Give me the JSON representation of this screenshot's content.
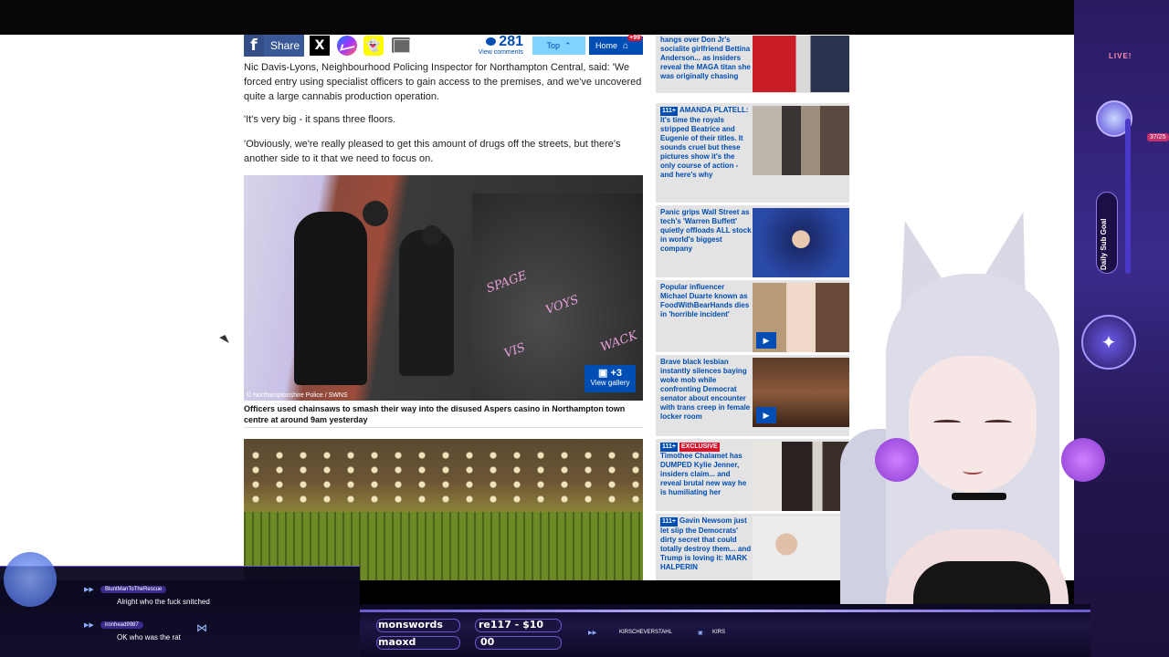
{
  "sharebar": {
    "share_label": "Share",
    "comments_count": "281",
    "comments_label": "View comments",
    "top_label": "Top",
    "home_label": "Home",
    "home_badge": "+99"
  },
  "article": {
    "p1": "Nic Davis-Lyons, Neighbourhood Policing Inspector for Northampton Central, said: 'We forced entry using specialist officers to gain access to the premises, and we've uncovered quite a large cannabis production operation.",
    "p2": "'It's very big - it spans three floors.",
    "p3": "'Obviously, we're really pleased to get this amount of drugs off the streets, but there's another side to it that we need to focus on.",
    "image_credit": "© Northamptonshire Police / SWNS",
    "gallery_count": "+3",
    "gallery_label": "View gallery",
    "caption": "Officers used chainsaws to smash their way into the disused Aspers casino in Northampton town centre at around 9am yesterday",
    "graffiti": [
      "SPAGE",
      "VOYS",
      "VIS",
      "WACK"
    ]
  },
  "sidebar": {
    "items": [
      {
        "tag": "",
        "text": "hangs over Don Jr's socialite girlfriend Bettina Anderson... as insiders reveal the MAGA titan she was originally chasing"
      },
      {
        "tag": "111+",
        "text": "AMANDA PLATELL: It's time the royals stripped Beatrice and Eugenie of their titles. It sounds cruel but these pictures show it's the only course of action - and here's why"
      },
      {
        "tag": "",
        "text": "Panic grips Wall Street as tech's 'Warren Buffett' quietly offloads ALL stock in world's biggest company"
      },
      {
        "tag": "",
        "text": "Popular influencer Michael Duarte known as FoodWithBearHands dies in 'horrible incident'"
      },
      {
        "tag": "",
        "text": "Brave black lesbian instantly silences baying woke mob while confronting Democrat senator about encounter with trans creep in female locker room"
      },
      {
        "tag": "111+",
        "tag2": "EXCLUSIVE",
        "text": "Timothee Chalamet has DUMPED Kylie Jenner, insiders claim... and reveal brutal new way he is humiliating her"
      },
      {
        "tag": "111+",
        "text": "Gavin Newsom just let slip the Democrats' dirty secret that could totally destroy them... and Trump is loving it: MARK HALPERIN"
      }
    ]
  },
  "overlay": {
    "live_label": "LIVE!",
    "goal_label": "Daily Sub Goal",
    "goal_counter": "37/25",
    "chat": [
      {
        "user": "BluntManToTheRescue",
        "message": "Alright who the fuck snitched"
      },
      {
        "user": "ironhead9987",
        "message": "OK who was the rat"
      }
    ],
    "ticker_top_left": "monswords",
    "ticker_top_mid": "re117 - $10",
    "ticker_bot_left": "maoxd",
    "ticker_bot_mid": "00",
    "ticker_name1": "KIRSCHEVERSTAHL",
    "ticker_name2": "KIRS"
  },
  "colors": {
    "dm_blue": "#004db3",
    "facebook": "#3b5998",
    "overlay_purple": "#3b2a8c",
    "badge_red": "#e0102d"
  },
  "icons": [
    "facebook-icon",
    "x-icon",
    "messenger-icon",
    "snapchat-icon",
    "mail-icon",
    "comment-bubble-icon",
    "chevron-up-icon",
    "home-icon",
    "camera-icon",
    "play-icon",
    "star-icon"
  ]
}
